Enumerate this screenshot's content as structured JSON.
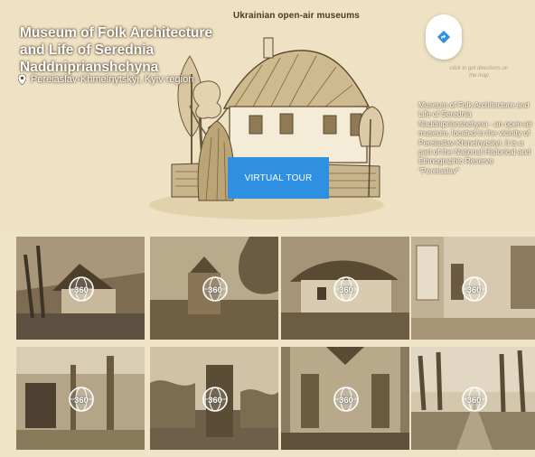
{
  "header": {
    "brand": "Ukrainian open-air museums",
    "title": "Museum of Folk Architecture and Life of Serednia Naddniprianshchyna",
    "location": "Pereiaslav-Khmelnytskyi, Kyiv region"
  },
  "actions": {
    "virtual_tour": "VIRTUAL TOUR",
    "directions_hint": "click to get directions on the map"
  },
  "description": "Museum of Folk Architecture and Life of Serednia Naddniprianshchyna - an open-air museum, located in the vicinity of Pereiaslav-Khmelnytskyi. It is a part of the National Historical and Ethnographic Reserve \"Pereiaslav\"",
  "gallery": {
    "badge": "360",
    "items": [
      {
        "scene": "house-with-fence"
      },
      {
        "scene": "wooden-church"
      },
      {
        "scene": "thatched-hut"
      },
      {
        "scene": "interior-room"
      },
      {
        "scene": "interior-loom"
      },
      {
        "scene": "windmill"
      },
      {
        "scene": "church-interior"
      },
      {
        "scene": "alley-trees"
      }
    ]
  },
  "colors": {
    "accent": "#2f8fe0",
    "background": "#efe2c4"
  }
}
